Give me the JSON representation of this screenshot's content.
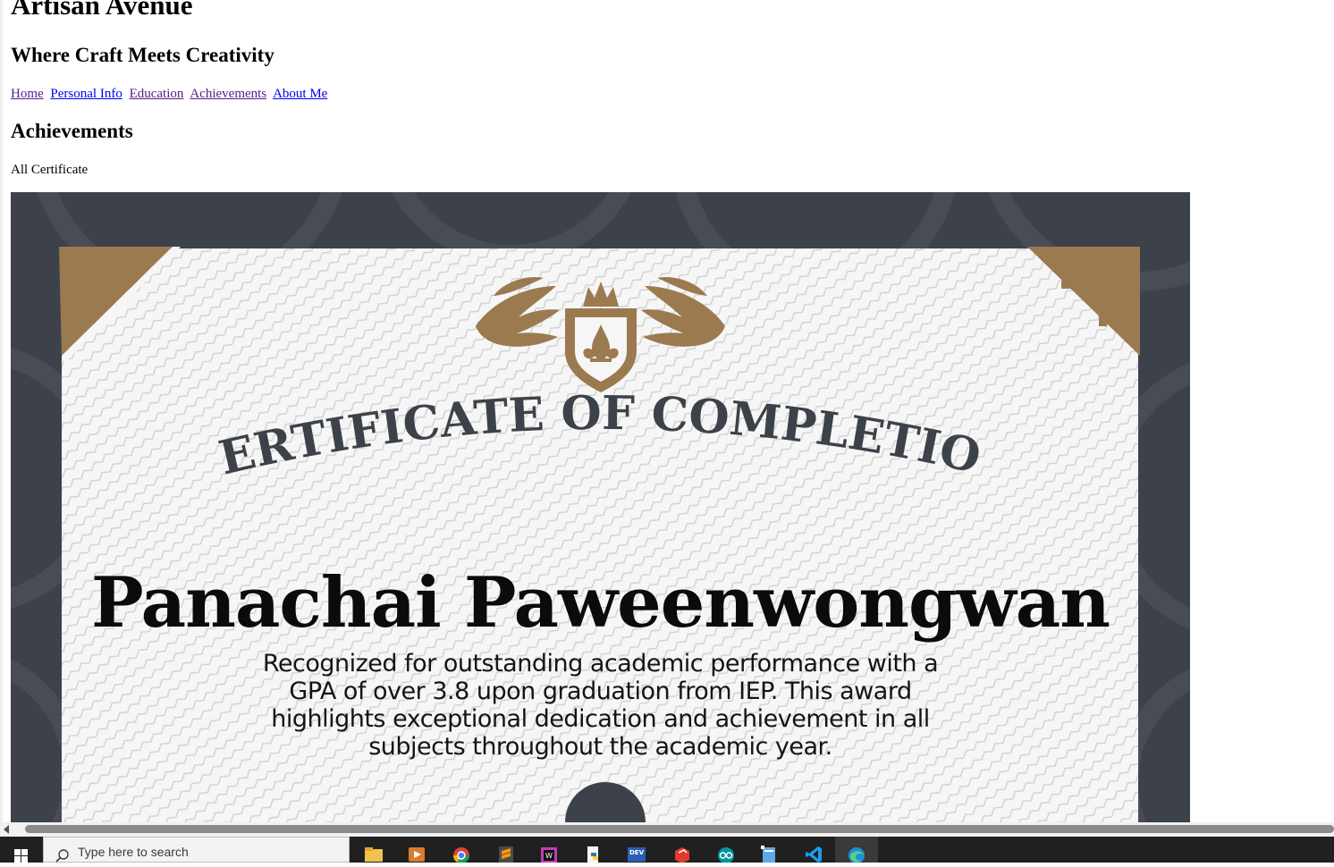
{
  "site": {
    "title": "Artisan Avenue",
    "tagline": "Where Craft Meets Creativity"
  },
  "nav": {
    "items": [
      {
        "label": "Home"
      },
      {
        "label": "Personal Info"
      },
      {
        "label": "Education"
      },
      {
        "label": "Achievements"
      },
      {
        "label": "About Me"
      }
    ]
  },
  "section": {
    "title": "Achievements",
    "subtitle": "All Certificate"
  },
  "certificate": {
    "heading": "CERTIFICATE OF COMPLETION",
    "recipient": "Panachai Paweenwongwan",
    "description": "Recognized for outstanding academic performance with a GPA of over 3.8 upon graduation from IEP. This award highlights exceptional dedication and achievement in all subjects throughout the academic year.",
    "colors": {
      "frame": "#3d424a",
      "paper": "#f6f6f6",
      "gold": "#9c7a50",
      "heading": "#3d424a"
    }
  },
  "taskbar": {
    "search_placeholder": "Type here to search",
    "apps": [
      {
        "icon": "file-explorer-icon"
      },
      {
        "icon": "media-player-icon"
      },
      {
        "icon": "chrome-icon"
      },
      {
        "icon": "sublime-text-icon"
      },
      {
        "icon": "webstorm-icon"
      },
      {
        "icon": "python-icon"
      },
      {
        "icon": "dev-cpp-icon"
      },
      {
        "icon": "sketchup-icon"
      },
      {
        "icon": "arduino-icon"
      },
      {
        "icon": "notepad-icon"
      },
      {
        "icon": "vscode-icon"
      },
      {
        "icon": "edge-icon"
      }
    ]
  }
}
